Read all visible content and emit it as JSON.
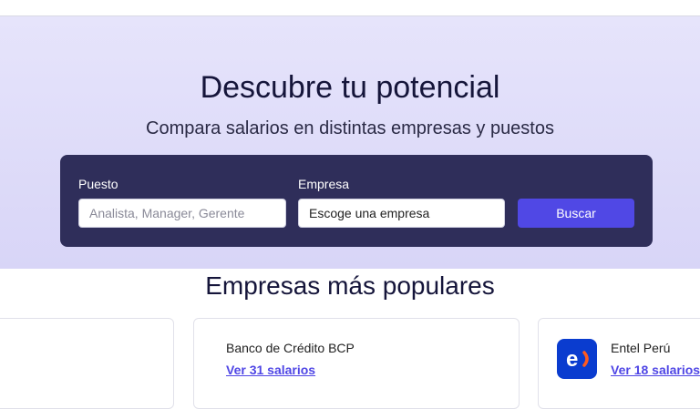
{
  "hero": {
    "title": "Descubre tu potencial",
    "subtitle": "Compara salarios en distintas empresas y puestos"
  },
  "search": {
    "puesto_label": "Puesto",
    "puesto_placeholder": "Analista, Manager, Gerente",
    "empresa_label": "Empresa",
    "empresa_value": "Escoge una empresa",
    "button_label": "Buscar"
  },
  "popular": {
    "title": "Empresas más populares",
    "cards": [
      {
        "name": "",
        "link": ""
      },
      {
        "name": "Banco de Crédito BCP",
        "link": "Ver 31 salarios"
      },
      {
        "name": "Entel Perú",
        "link": "Ver 18 salarios",
        "logo_icon": "entel-logo-icon"
      }
    ]
  },
  "colors": {
    "hero_bg": "#e2e0fa",
    "search_card_bg": "#2f2e5a",
    "primary_button": "#5048e5",
    "link": "#4f46e5",
    "entel_blue": "#0a3ccf",
    "entel_accent": "#ff5a1f"
  }
}
